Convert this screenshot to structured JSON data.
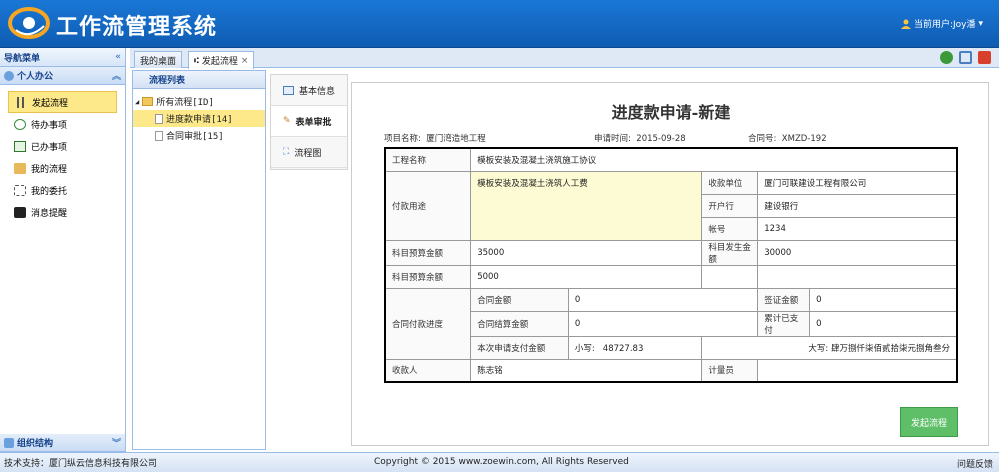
{
  "header": {
    "app_title": "工作流管理系统",
    "user_label": "当前用户:Joy潘"
  },
  "sidebar": {
    "title": "导航菜单",
    "section": "个人办公",
    "items": [
      {
        "label": "发起流程"
      },
      {
        "label": "待办事项"
      },
      {
        "label": "已办事项"
      },
      {
        "label": "我的流程"
      },
      {
        "label": "我的委托"
      },
      {
        "label": "消息提醒"
      }
    ],
    "bottom_section": "组织结构"
  },
  "tabs": [
    {
      "label": "我的桌面"
    },
    {
      "label": "发起流程"
    }
  ],
  "tree": {
    "title": "流程列表",
    "root": "所有流程[ID]",
    "children": [
      {
        "label": "进度款申请[14]"
      },
      {
        "label": "合同审批[15]"
      }
    ]
  },
  "subtabs": [
    {
      "label": "基本信息"
    },
    {
      "label": "表单审批"
    },
    {
      "label": "流程图"
    }
  ],
  "form": {
    "title": "进度款申请-新建",
    "project_label": "项目名称:",
    "project_value": "厦门湾造地工程",
    "date_label": "申请时间:",
    "date_value": "2015-09-28",
    "contract_label": "合同号:",
    "contract_value": "XMZD-192",
    "rows": {
      "project_name_label": "工程名称",
      "project_name_value": "模板安装及混凝土浇筑施工协议",
      "purpose_label": "付款用途",
      "purpose_value": "模板安装及混凝土浇筑人工费",
      "payee_unit_label": "收款单位",
      "payee_unit_value": "厦门可联建设工程有限公司",
      "bank_label": "开户行",
      "bank_value": "建设银行",
      "account_label": "帐号",
      "account_value": "1234",
      "budget_total_label": "科目预算金额",
      "budget_total_value": "35000",
      "budget_spent_label": "科目发生金额",
      "budget_spent_value": "30000",
      "budget_remain_label": "科目预算余额",
      "budget_remain_value": "5000",
      "progress_label": "合同付款进度",
      "contract_amount_label": "合同金额",
      "contract_amount_value": "0",
      "visa_amount_label": "签证金额",
      "visa_amount_value": "0",
      "settle_amount_label": "合同结算金额",
      "settle_amount_value": "0",
      "paid_total_label": "累计已支付",
      "paid_total_value": "0",
      "this_pay_label": "本次申请支付金额",
      "small_label": "小写:",
      "small_value": "48727.83",
      "big_label": "大写:",
      "big_value": "肆万捌仟柒佰贰拾柒元捌角叁分",
      "receiver_label": "收款人",
      "receiver_value": "陈志铭",
      "meter_label": "计量员",
      "meter_value": ""
    },
    "submit_label": "发起流程"
  },
  "footer": {
    "support": "技术支持：厦门纵云信息科技有限公司",
    "copyright": "Copyright © 2015 www.zoewin.com, All Rights Reserved",
    "feedback": "问题反馈"
  },
  "colors": {
    "header_blue": "#1a77d6",
    "highlight": "#fde98a",
    "button_green": "#5fbf68",
    "panel_border": "#99bbe8"
  }
}
